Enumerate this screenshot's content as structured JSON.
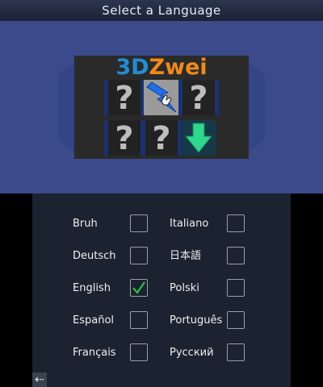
{
  "header": {
    "title": "Select a Language"
  },
  "logo": {
    "part1": "3D",
    "part2": "Zwei"
  },
  "tiles": {
    "question_mark": "?",
    "items": [
      {
        "name": "unknown",
        "glyph": "?"
      },
      {
        "name": "lightning",
        "glyph": ""
      },
      {
        "name": "unknown",
        "glyph": "?"
      },
      {
        "name": "unknown",
        "glyph": "?"
      },
      {
        "name": "unknown",
        "glyph": "?"
      },
      {
        "name": "download-arrow",
        "glyph": ""
      }
    ]
  },
  "languages": {
    "left": [
      {
        "label": "Bruh",
        "checked": false
      },
      {
        "label": "Deutsch",
        "checked": false
      },
      {
        "label": "English",
        "checked": true
      },
      {
        "label": "Español",
        "checked": false
      },
      {
        "label": "Français",
        "checked": false
      }
    ],
    "right": [
      {
        "label": "Italiano",
        "checked": false
      },
      {
        "label": "日本語",
        "checked": false
      },
      {
        "label": "Polski",
        "checked": false
      },
      {
        "label": "Português",
        "checked": false
      },
      {
        "label": "Русский",
        "checked": false
      }
    ]
  },
  "footer": {
    "back_icon": "back-arrow-icon",
    "back_glyph": "⇠"
  },
  "colors": {
    "top_background": "#3b4a8a",
    "bottom_background": "#1b2230",
    "check": "#2ecc40",
    "logo_3d": "#1f8fd6",
    "logo_zwei": "#ef8a1a"
  }
}
